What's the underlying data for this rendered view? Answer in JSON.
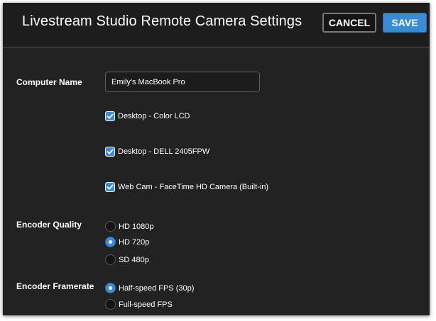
{
  "header": {
    "title": "Livestream Studio Remote Camera Settings",
    "cancel_label": "CANCEL",
    "save_label": "SAVE"
  },
  "computer_name": {
    "label": "Computer Name",
    "value": "Emily's MacBook Pro"
  },
  "cameras": [
    {
      "label": "Desktop - Color LCD",
      "checked": true
    },
    {
      "label": "Desktop - DELL 2405FPW",
      "checked": true
    },
    {
      "label": "Web Cam - FaceTime HD Camera (Built-in)",
      "checked": true
    }
  ],
  "encoder_quality": {
    "label": "Encoder Quality",
    "options": [
      {
        "label": "HD 1080p",
        "selected": false
      },
      {
        "label": "HD 720p",
        "selected": true
      },
      {
        "label": "SD 480p",
        "selected": false
      }
    ]
  },
  "encoder_framerate": {
    "label": "Encoder Framerate",
    "options": [
      {
        "label": "Half-speed FPS (30p)",
        "selected": true
      },
      {
        "label": "Full-speed FPS",
        "selected": false
      }
    ]
  },
  "colors": {
    "accent": "#3c8ad6",
    "background": "#222222",
    "header": "#1d1d1d"
  }
}
